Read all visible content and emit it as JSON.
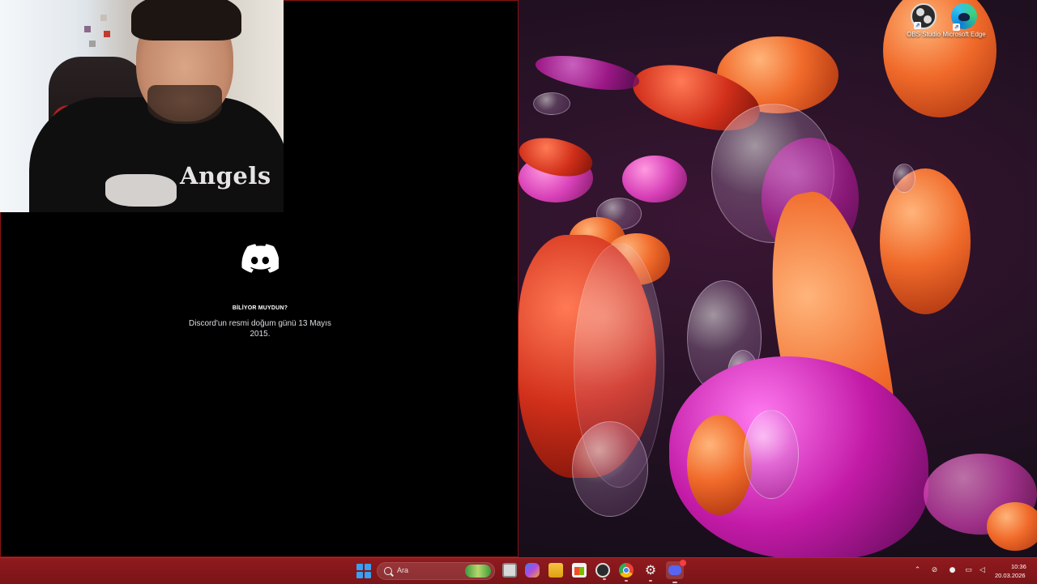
{
  "desktop": {
    "icons": [
      {
        "label": "OBS Studio",
        "icon": "obs-studio-icon"
      },
      {
        "label": "Microsoft Edge",
        "icon": "edge-icon"
      }
    ]
  },
  "discord": {
    "tip_title": "BİLİYOR MUYDUN?",
    "tip_body": "Discord'un resmi doğum günü 13 Mayıs 2015."
  },
  "webcam": {
    "shirt_text": "Angels"
  },
  "taskbar": {
    "search_placeholder": "Ara",
    "apps": [
      "start-icon",
      "task-view-icon",
      "copilot-icon",
      "file-explorer-icon",
      "microsoft-store-icon",
      "obs-studio-icon",
      "chrome-icon",
      "settings-icon",
      "discord-icon"
    ],
    "clock_time": "10:36",
    "clock_date": "20.03.2026"
  },
  "colors": {
    "taskbar": "#7a1418",
    "discord_bg": "#000000",
    "window_border": "#8a1212",
    "discord_blurple": "#5865f2"
  }
}
